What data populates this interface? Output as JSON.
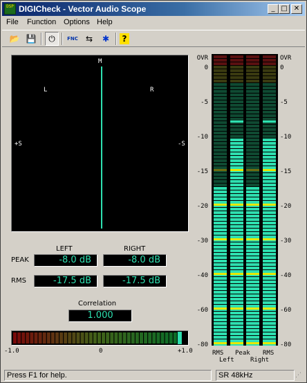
{
  "window": {
    "title": "DIGICheck - Vector Audio Scope",
    "app_icon_text": "DSP",
    "minimize": "_",
    "maximize": "□",
    "close": "✕"
  },
  "menu": {
    "items": [
      "File",
      "Function",
      "Options",
      "Help"
    ]
  },
  "toolbar": {
    "buttons": [
      {
        "name": "open-icon",
        "glyph": "📂",
        "pressed": false
      },
      {
        "name": "save-icon",
        "glyph": "💾",
        "pressed": false
      },
      {
        "name": "power-icon",
        "glyph": "⏻",
        "pressed": true
      },
      {
        "name": "function-icon",
        "glyph": "FNC",
        "pressed": false
      },
      {
        "name": "settings-icon",
        "glyph": "⇆",
        "pressed": false
      },
      {
        "name": "bug-icon",
        "glyph": "✱",
        "pressed": false
      },
      {
        "name": "help-icon",
        "glyph": "?",
        "pressed": false
      }
    ]
  },
  "scope": {
    "top": "M",
    "left": "L",
    "right": "R",
    "plus_s": "+S",
    "minus_s": "-S"
  },
  "levels": {
    "left_header": "LEFT",
    "right_header": "RIGHT",
    "peak_label": "PEAK",
    "rms_label": "RMS",
    "peak_left": "-8.0 dB",
    "peak_right": "-8.0 dB",
    "rms_left": "-17.5 dB",
    "rms_right": "-17.5 dB"
  },
  "correlation": {
    "label": "Correlation",
    "value": "1.000",
    "value_num": 1.0,
    "min_label": "-1.0",
    "mid_label": "0",
    "max_label": "+1.0"
  },
  "meters": {
    "scale": [
      "OVR",
      "0",
      "-5",
      "-10",
      "-15",
      "-20",
      "-30",
      "-40",
      "-60",
      "-80"
    ],
    "columns": [
      {
        "line1": "RMS",
        "line2": "",
        "level_db": -17.5,
        "peak_db": null
      },
      {
        "line1": "Peak",
        "line2": "Left",
        "level_db": -10.5,
        "peak_db": -8.0
      },
      {
        "line1": "RMS",
        "line2": "",
        "level_db": -17.5,
        "peak_db": null
      },
      {
        "line1": "",
        "line2": "Right",
        "level_db": -10.5,
        "peak_db": -8.0
      }
    ],
    "bottom_left": "RMS",
    "bottom_peak": "Peak",
    "bottom_right": "RMS",
    "bottom_left_channel": "Left",
    "bottom_right_channel": "Right"
  },
  "status": {
    "help": "Press F1 for help.",
    "samplerate": "SR 48kHz"
  },
  "colors": {
    "level": "#2ee0b0",
    "peak_marker": "#2ee0b0",
    "scale_mark": "#e8e800"
  }
}
